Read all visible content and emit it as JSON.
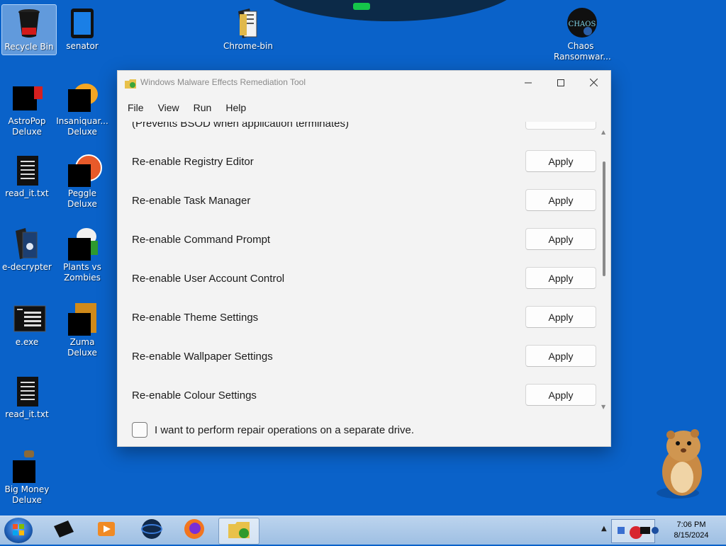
{
  "desktop": {
    "icons": [
      {
        "label": "Recycle Bin"
      },
      {
        "label": "senator"
      },
      {
        "label": "Chrome-bin"
      },
      {
        "label": "Chaos Ransomwar..."
      },
      {
        "label": "AstroPop Deluxe"
      },
      {
        "label": "Insaniquar... Deluxe"
      },
      {
        "label": "read_it.txt"
      },
      {
        "label": "Peggle Deluxe"
      },
      {
        "label": "e-decrypter"
      },
      {
        "label": "Plants vs Zombies"
      },
      {
        "label": "e.exe"
      },
      {
        "label": "Zuma Deluxe"
      },
      {
        "label": "read_it.txt"
      },
      {
        "label": "Big Money Deluxe"
      }
    ],
    "chaos_logo_text": "CHAOS"
  },
  "window": {
    "title": "Windows Malware Effects Remediation Tool",
    "menu": [
      "File",
      "View",
      "Run",
      "Help"
    ],
    "cutoff_text": "(Prevents BSOD when application terminates)",
    "rows": [
      {
        "label": "Re-enable Registry Editor",
        "button": "Apply"
      },
      {
        "label": "Re-enable Task Manager",
        "button": "Apply"
      },
      {
        "label": "Re-enable Command Prompt",
        "button": "Apply"
      },
      {
        "label": "Re-enable User Account Control",
        "button": "Apply"
      },
      {
        "label": "Re-enable Theme Settings",
        "button": "Apply"
      },
      {
        "label": "Re-enable Wallpaper Settings",
        "button": "Apply"
      },
      {
        "label": "Re-enable Colour Settings",
        "button": "Apply"
      }
    ],
    "checkbox_label": "I want to perform repair operations on a separate drive.",
    "checkbox_checked": false
  },
  "taskbar": {
    "time": "7:06 PM",
    "date": "8/15/2024"
  },
  "colors": {
    "desktop_bg": "#0a62c9",
    "taskbar": "#a9c7e8",
    "window_bg": "#f3f3f3"
  }
}
